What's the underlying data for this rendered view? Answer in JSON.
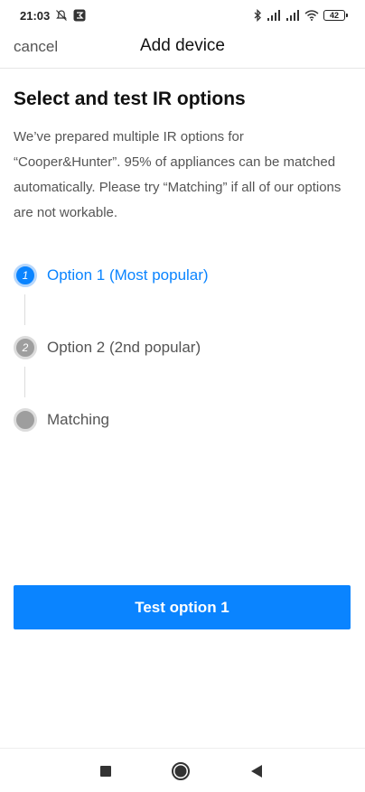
{
  "status_bar": {
    "time": "21:03",
    "battery": "42"
  },
  "header": {
    "cancel_label": "cancel",
    "title": "Add device"
  },
  "content": {
    "title": "Select and test IR options",
    "description": "We’ve prepared multiple IR options for “Cooper&Hunter”. 95% of appliances can be matched automatically. Please try “Matching” if all of our options are not workable."
  },
  "steps": [
    {
      "number": "1",
      "label": "Option 1 (Most popular)",
      "state": "active"
    },
    {
      "number": "2",
      "label": "Option 2 (2nd popular)",
      "state": "inactive"
    },
    {
      "number": "",
      "label": "Matching",
      "state": "inactive"
    }
  ],
  "action": {
    "button_label": "Test option 1"
  },
  "colors": {
    "accent": "#0a84ff",
    "text_primary": "#111111",
    "text_secondary": "#555555",
    "inactive_step": "#9e9e9e"
  },
  "icons": {
    "status_left": [
      "notification-off-icon",
      "app-notification-icon"
    ],
    "status_right": [
      "bluetooth-icon",
      "signal-icon",
      "signal-icon",
      "wifi-icon",
      "battery-icon"
    ],
    "nav": [
      "recents-square-icon",
      "home-circle-icon",
      "back-triangle-icon"
    ]
  }
}
